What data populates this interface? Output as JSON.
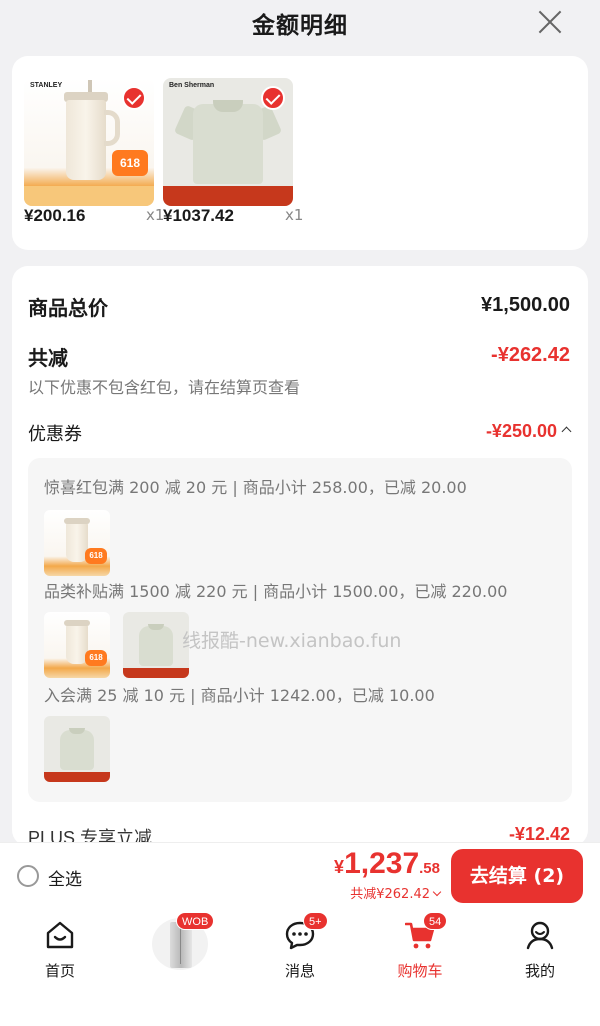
{
  "header": {
    "title": "金额明细"
  },
  "products": [
    {
      "price": "¥200.16",
      "qty": "x1",
      "brand": "STANLEY",
      "badge": "618"
    },
    {
      "price": "¥1037.42",
      "qty": "x1",
      "brand": "Ben Sherman",
      "badge": ""
    }
  ],
  "summary": {
    "total_label": "商品总价",
    "total_value": "¥1,500.00",
    "discount_label": "共减",
    "discount_value": "-¥262.42",
    "note": "以下优惠不包含红包，请在结算页查看",
    "coupon_label": "优惠券",
    "coupon_value": "-¥250.00"
  },
  "coupons": [
    "惊喜红包满 200 减 20 元 | 商品小计 258.00，已减 20.00",
    "品类补贴满 1500 减 220 元 | 商品小计 1500.00，已减 220.00",
    "入会满 25 减 10 元 | 商品小计 1242.00，已减 10.00"
  ],
  "watermark": "线报酷-new.xianbao.fun",
  "plus": {
    "label": "PLUS 专享立减",
    "value": "-¥12.42"
  },
  "checkout": {
    "select_all": "全选",
    "currency": "¥",
    "total_int": "1,237",
    "total_dec": ".58",
    "saved": "共减¥262.42",
    "pay_button": "去结算 (2)"
  },
  "tabs": [
    {
      "label": "首页",
      "icon": "home-icon"
    },
    {
      "label": "",
      "icon": "fridge-promo-icon",
      "badge": "WOB"
    },
    {
      "label": "消息",
      "icon": "message-icon",
      "badge": "5+"
    },
    {
      "label": "购物车",
      "icon": "cart-icon",
      "badge": "54"
    },
    {
      "label": "我的",
      "icon": "profile-icon"
    }
  ],
  "colors": {
    "accent": "#e8322f",
    "background": "#f1f1f3"
  }
}
